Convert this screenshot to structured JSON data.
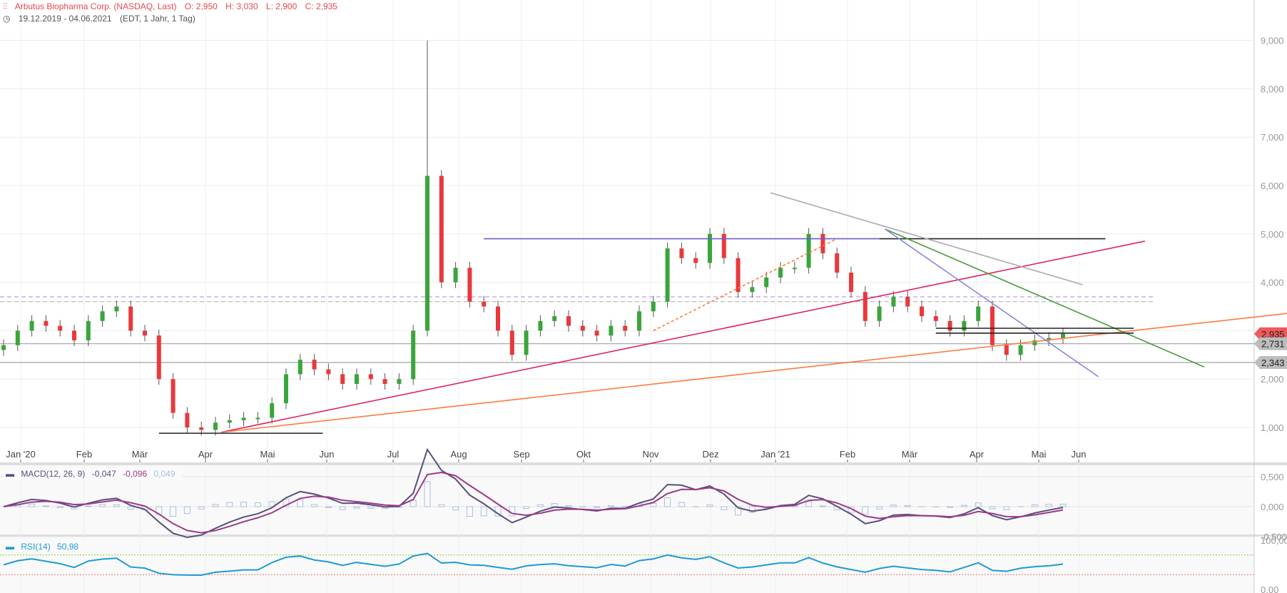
{
  "header": {
    "title": "Arbutus Biopharma Corp. (NASDAQ, Last)",
    "open": "O: 2,950",
    "high": "H: 3,030",
    "low": "L: 2,900",
    "close": "C: 2,935",
    "range": "19.12.2019 - 04.06.2021",
    "range_info": "(EDT, 1 Jahr, 1 Tag)",
    "icons": {
      "chart": "candlestick-settings-icon",
      "clock": "clock-icon"
    }
  },
  "colors": {
    "up": "#3aa53a",
    "down": "#e8393c",
    "accent": "#e8474c",
    "macd": "#5b4e7d",
    "signal": "#9b3a8a",
    "hist": "#a9c0de",
    "rsi": "#1e9ad6"
  },
  "price_tags": [
    {
      "label": "2,935",
      "value": 2.935,
      "color": "#ef5a5a"
    },
    {
      "label": "2,731",
      "value": 2.731,
      "color": "#bdbdbd"
    },
    {
      "label": "2,343",
      "value": 2.343,
      "color": "#bdbdbd"
    }
  ],
  "macd": {
    "label": "MACD(12, 26, 9)",
    "macd": "-0,047",
    "signal": "-0,096",
    "hist": "0,049",
    "ticks": [
      "0,500",
      "0,000",
      "-0,500"
    ]
  },
  "rsi": {
    "label": "RSI(14)",
    "value": "50,98",
    "ticks": [
      "100,00",
      "0,00"
    ]
  },
  "chart_data": {
    "type": "candlestick",
    "xlabels": [
      "Jan '20",
      "Feb",
      "Mär",
      "Apr",
      "Mai",
      "Jun",
      "Jul",
      "Aug",
      "Sep",
      "Okt",
      "Nov",
      "Dez",
      "Jan '21",
      "Feb",
      "Mär",
      "Apr",
      "Mai",
      "Jun"
    ],
    "yticks": [
      "1,000",
      "2,000",
      "3,000",
      "4,000",
      "5,000",
      "6,000",
      "7,000",
      "8,000",
      "9,000"
    ],
    "ylim": [
      0.5,
      9.5
    ],
    "grid": true,
    "closes": [
      2.7,
      3.0,
      3.2,
      3.1,
      3.0,
      2.8,
      3.2,
      3.4,
      3.5,
      3.0,
      2.9,
      2.0,
      1.3,
      1.0,
      0.95,
      1.1,
      1.15,
      1.2,
      1.2,
      1.5,
      2.1,
      2.4,
      2.2,
      2.1,
      1.9,
      2.1,
      2.0,
      1.9,
      2.0,
      3.0,
      6.2,
      4.0,
      4.3,
      3.6,
      3.5,
      3.0,
      2.5,
      3.0,
      3.2,
      3.3,
      3.1,
      3.0,
      2.9,
      3.1,
      3.0,
      3.4,
      3.6,
      4.7,
      4.5,
      4.4,
      5.0,
      4.5,
      3.8,
      3.9,
      4.1,
      4.3,
      4.3,
      5.0,
      4.6,
      4.2,
      3.8,
      3.2,
      3.5,
      3.7,
      3.5,
      3.3,
      3.2,
      3.0,
      3.2,
      3.5,
      2.7,
      2.5,
      2.7,
      2.8,
      2.85,
      2.935
    ],
    "spike_high": {
      "index": 30,
      "value": 9.0
    },
    "hlines": [
      {
        "value": 2.731,
        "color": "#aaaaaa"
      },
      {
        "value": 2.343,
        "color": "#aaaaaa"
      },
      {
        "value": 3.7,
        "color": "#c6a9e8",
        "dashed": true
      },
      {
        "value": 3.6,
        "color": "#bbbbbb",
        "dashed": true
      }
    ],
    "trendlines": [
      {
        "from": [
          15.4,
          0.9
        ],
        "to": [
          80.8,
          4.85
        ],
        "color": "#e0245e"
      },
      {
        "from": [
          15.4,
          0.9
        ],
        "to": [
          92.2,
          3.4
        ],
        "color": "#ff7a3d"
      },
      {
        "from": [
          34,
          4.9
        ],
        "to": [
          62,
          4.9
        ],
        "color": "#6a5acd"
      },
      {
        "from": [
          62,
          4.9
        ],
        "to": [
          78,
          4.9
        ],
        "color": "#222222"
      },
      {
        "from": [
          54.3,
          5.85
        ],
        "to": [
          76.4,
          3.95
        ],
        "color": "#aaaaaa"
      },
      {
        "from": [
          62.4,
          5.1
        ],
        "to": [
          85,
          2.25
        ],
        "color": "#4a9a3a"
      },
      {
        "from": [
          62.4,
          5.1
        ],
        "to": [
          77.5,
          2.05
        ],
        "color": "#8888dd"
      },
      {
        "from": [
          11,
          0.88
        ],
        "to": [
          22.6,
          0.88
        ],
        "color": "#222222"
      },
      {
        "from": [
          66,
          3.05
        ],
        "to": [
          80,
          3.05
        ],
        "color": "#222222"
      },
      {
        "from": [
          66,
          2.95
        ],
        "to": [
          80,
          2.95
        ],
        "color": "#222222"
      },
      {
        "from": [
          46,
          3.0
        ],
        "to": [
          59,
          4.9
        ],
        "color": "#ff7a3d",
        "dashed": true
      }
    ]
  }
}
